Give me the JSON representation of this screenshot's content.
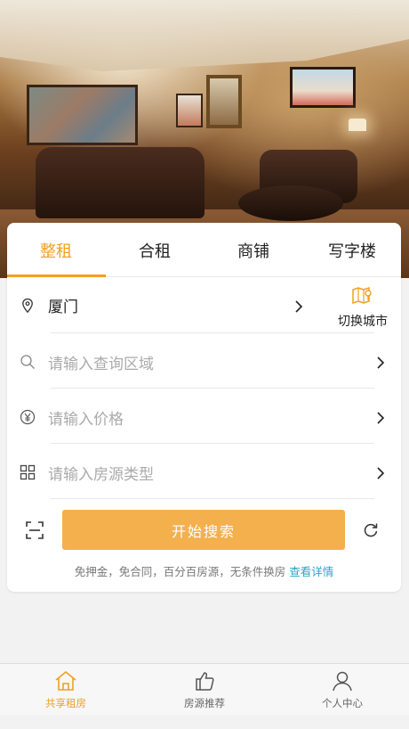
{
  "tabs": [
    {
      "label": "整租",
      "active": true
    },
    {
      "label": "合租",
      "active": false
    },
    {
      "label": "商铺",
      "active": false
    },
    {
      "label": "写字楼",
      "active": false
    }
  ],
  "location": {
    "city": "厦门",
    "switch_label": "切换城市",
    "icon": "location-pin-icon"
  },
  "fields": {
    "area_placeholder": "请输入查询区域",
    "price_placeholder": "请输入价格",
    "type_placeholder": "请输入房源类型"
  },
  "search": {
    "button_label": "开始搜索"
  },
  "promo": {
    "text": "免押金，免合同，百分百房源，无条件换房",
    "link": "查看详情"
  },
  "nav": [
    {
      "label": "共享租房",
      "icon": "home-icon",
      "active": true
    },
    {
      "label": "房源推荐",
      "icon": "thumbs-up-icon",
      "active": false
    },
    {
      "label": "个人中心",
      "icon": "user-icon",
      "active": false
    }
  ],
  "colors": {
    "accent": "#f0a020",
    "button": "#f3b04d",
    "link": "#2aa4c8"
  }
}
